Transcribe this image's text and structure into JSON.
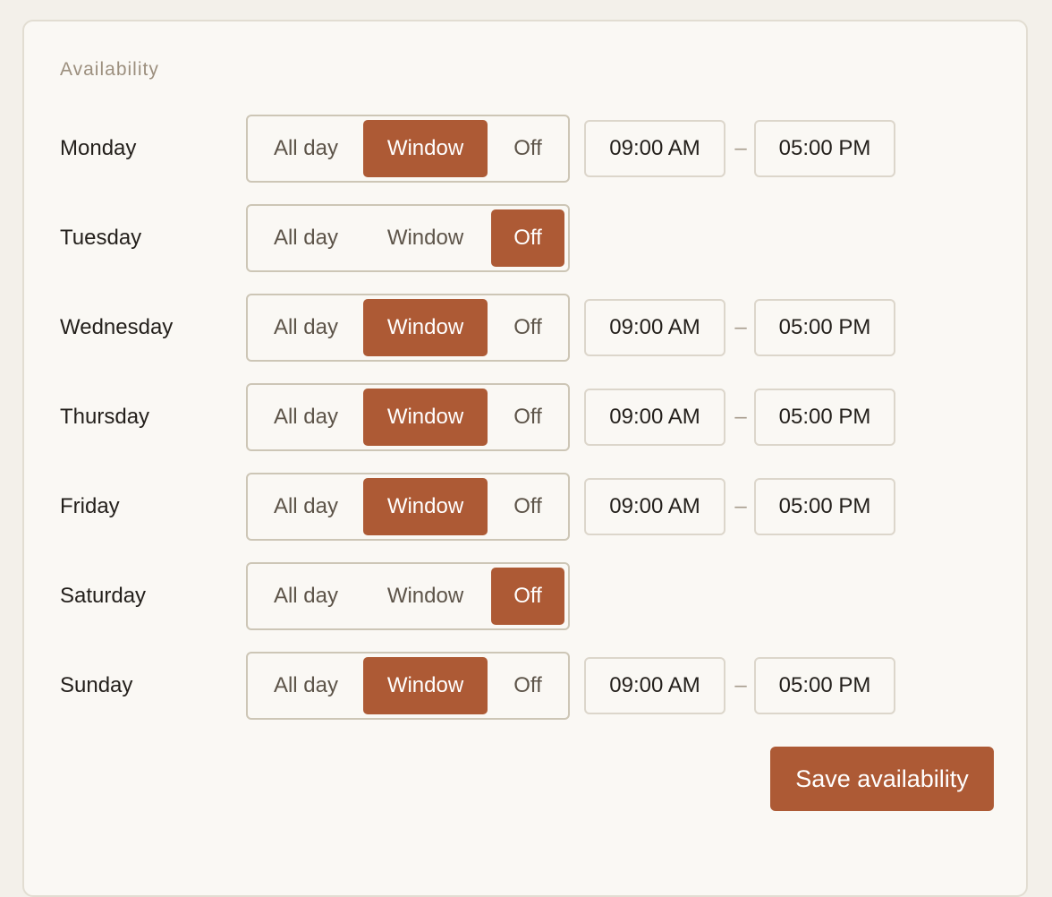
{
  "card": {
    "title": "Availability"
  },
  "options": {
    "all_day": "All day",
    "window": "Window",
    "off": "Off"
  },
  "days": [
    {
      "name": "Monday",
      "mode": "window",
      "start": "09:00 AM",
      "end": "05:00 PM"
    },
    {
      "name": "Tuesday",
      "mode": "off",
      "start": "",
      "end": ""
    },
    {
      "name": "Wednesday",
      "mode": "window",
      "start": "09:00 AM",
      "end": "05:00 PM"
    },
    {
      "name": "Thursday",
      "mode": "window",
      "start": "09:00 AM",
      "end": "05:00 PM"
    },
    {
      "name": "Friday",
      "mode": "window",
      "start": "09:00 AM",
      "end": "05:00 PM"
    },
    {
      "name": "Saturday",
      "mode": "off",
      "start": "",
      "end": ""
    },
    {
      "name": "Sunday",
      "mode": "window",
      "start": "09:00 AM",
      "end": "05:00 PM"
    }
  ],
  "separator": "–",
  "save_label": "Save availability",
  "colors": {
    "accent": "#ad5a35",
    "card_bg": "#faf8f4",
    "page_bg": "#f3f0ea"
  }
}
